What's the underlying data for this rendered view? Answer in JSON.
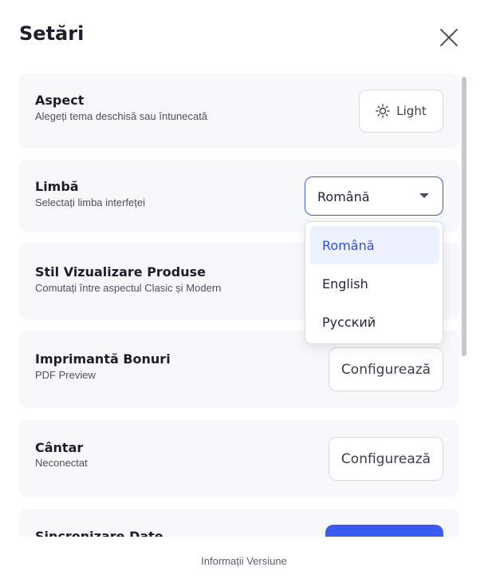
{
  "header": {
    "title": "Setări"
  },
  "settings": {
    "appearance": {
      "title": "Aspect",
      "subtitle": "Alegeți tema deschisă sau întunecată",
      "button_label": "Light"
    },
    "language": {
      "title": "Limbă",
      "subtitle": "Selectați limba interfeței",
      "selected": "Română",
      "options": [
        "Română",
        "English",
        "Русский"
      ]
    },
    "product_view": {
      "title": "Stil Vizualizare Produse",
      "subtitle": "Comutați între aspectul Clasic și Modern"
    },
    "printer": {
      "title": "Imprimantă Bonuri",
      "subtitle": "PDF Preview",
      "button_label": "Configurează"
    },
    "scale": {
      "title": "Cântar",
      "subtitle": "Neconectat",
      "button_label": "Configurează"
    },
    "sync": {
      "title": "Sincronizare Date"
    }
  },
  "footer": {
    "version_link": "Informații Versiune"
  },
  "colors": {
    "accent": "#3a5bf0",
    "selected_bg": "#eef1fe",
    "card_bg": "#f7f8fa"
  },
  "icons": {
    "close": "close-icon",
    "theme": "sun-icon",
    "dropdown": "chevron-down-icon"
  }
}
